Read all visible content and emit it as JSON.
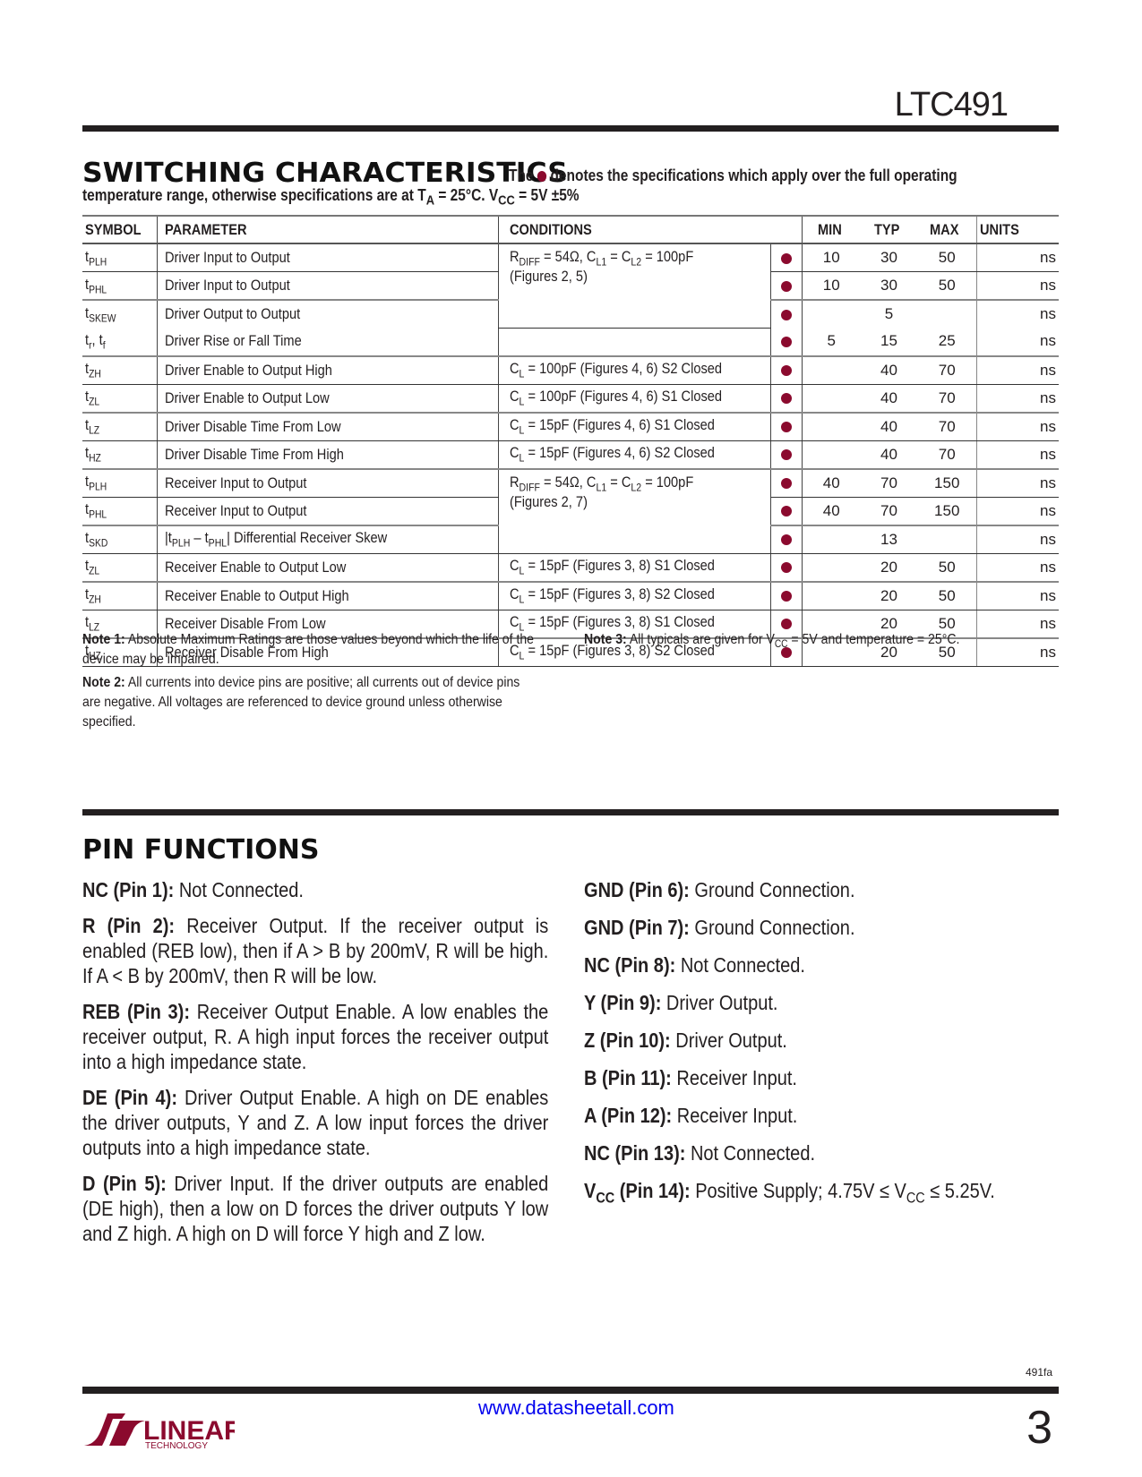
{
  "header": {
    "part_number": "LTC491"
  },
  "switching": {
    "title": "SWITCHING CHARACTERISTICS",
    "subtitle_prefix": "The",
    "subtitle_suffix": "denotes the specifications which apply over the full operating",
    "subtitle_line2": "temperature range, otherwise specifications are at T",
    "subtitle_line2_ta_sub": "A",
    "subtitle_line2_mid": " = 25°C. V",
    "subtitle_line2_vcc_sub": "CC",
    "subtitle_line2_end": " = 5V ±5%",
    "bullet_color": "#8b0a2e",
    "columns": {
      "symbol": "SYMBOL",
      "parameter": "PARAMETER",
      "conditions": "CONDITIONS",
      "min": "MIN",
      "typ": "TYP",
      "max": "MAX",
      "units": "UNITS"
    },
    "rows": [
      {
        "sym": "t",
        "sub": "PLH",
        "param": "Driver Input to Output",
        "cond": "R_DIFF = 54Ω, C_L1 = C_L2 = 100pF",
        "cond2": "(Figures 2, 5)",
        "min": "10",
        "typ": "30",
        "max": "50",
        "unit": "ns"
      },
      {
        "sym": "t",
        "sub": "PHL",
        "param": "Driver Input to Output",
        "cond": "",
        "min": "10",
        "typ": "30",
        "max": "50",
        "unit": "ns"
      },
      {
        "sym": "t",
        "sub": "SKEW",
        "param": "Driver Output to Output",
        "cond": "",
        "min": "",
        "typ": "5",
        "max": "",
        "unit": "ns"
      },
      {
        "sym": "t",
        "sub": "r",
        "sym2": ", t",
        "sub2": "f",
        "param": "Driver Rise or Fall Time",
        "cond": "",
        "min": "5",
        "typ": "15",
        "max": "25",
        "unit": "ns"
      },
      {
        "sym": "t",
        "sub": "ZH",
        "param": "Driver Enable to Output High",
        "cond": "C_L = 100pF (Figures 4, 6) S2 Closed",
        "min": "",
        "typ": "40",
        "max": "70",
        "unit": "ns"
      },
      {
        "sym": "t",
        "sub": "ZL",
        "param": "Driver Enable to Output Low",
        "cond": "C_L = 100pF (Figures 4, 6) S1 Closed",
        "min": "",
        "typ": "40",
        "max": "70",
        "unit": "ns"
      },
      {
        "sym": "t",
        "sub": "LZ",
        "param": "Driver Disable Time From Low",
        "cond": "C_L = 15pF (Figures 4, 6) S1 Closed",
        "min": "",
        "typ": "40",
        "max": "70",
        "unit": "ns"
      },
      {
        "sym": "t",
        "sub": "HZ",
        "param": "Driver Disable Time From High",
        "cond": "C_L = 15pF (Figures 4, 6) S2 Closed",
        "min": "",
        "typ": "40",
        "max": "70",
        "unit": "ns"
      },
      {
        "sym": "t",
        "sub": "PLH",
        "param": "Receiver Input to Output",
        "cond": "R_DIFF = 54Ω, C_L1 = C_L2 = 100pF",
        "cond2": "(Figures 2, 7)",
        "min": "40",
        "typ": "70",
        "max": "150",
        "unit": "ns"
      },
      {
        "sym": "t",
        "sub": "PHL",
        "param": "Receiver Input to Output",
        "cond": "",
        "min": "40",
        "typ": "70",
        "max": "150",
        "unit": "ns"
      },
      {
        "sym": "t",
        "sub": "SKD",
        "param": "|t_PLH – t_PHL| Differential Receiver Skew",
        "cond": "",
        "min": "",
        "typ": "13",
        "max": "",
        "unit": "ns"
      },
      {
        "sym": "t",
        "sub": "ZL",
        "param": "Receiver Enable to Output Low",
        "cond": "C_L = 15pF (Figures 3, 8) S1 Closed",
        "min": "",
        "typ": "20",
        "max": "50",
        "unit": "ns"
      },
      {
        "sym": "t",
        "sub": "ZH",
        "param": "Receiver Enable to Output High",
        "cond": "C_L = 15pF (Figures 3, 8) S2 Closed",
        "min": "",
        "typ": "20",
        "max": "50",
        "unit": "ns"
      },
      {
        "sym": "t",
        "sub": "LZ",
        "param": "Receiver Disable From Low",
        "cond": "C_L = 15pF (Figures 3, 8) S1 Closed",
        "min": "",
        "typ": "20",
        "max": "50",
        "unit": "ns"
      },
      {
        "sym": "t",
        "sub": "HZ",
        "param": "Receiver Disable From High",
        "cond": "C_L = 15pF (Figures 3, 8) S2 Closed",
        "min": "",
        "typ": "20",
        "max": "50",
        "unit": "ns"
      }
    ]
  },
  "notes": {
    "note1_label": "Note 1:",
    "note1_text": " Absolute Maximum Ratings are those values beyond which the life of the device may be impaired.",
    "note2_label": "Note 2:",
    "note2_text": " All currents into device pins are positive; all currents out of device pins are negative. All voltages are referenced to device ground unless otherwise specified.",
    "note3_label": "Note 3:",
    "note3_text": " All typicals are given for V_CC = 5V and temperature = 25°C."
  },
  "pin_functions": {
    "title": "PIN FUNCTIONS",
    "left": [
      {
        "label": "NC (Pin 1):",
        "text": " Not Connected."
      },
      {
        "label": "R (Pin 2):",
        "text": " Receiver Output. If the receiver output is enabled (REB low), then if A > B by 200mV, R will be high. If A < B by 200mV, then R will be low."
      },
      {
        "label": "REB (Pin 3):",
        "text": " Receiver Output Enable. A low enables the receiver output, R. A high input forces the receiver output into a high impedance state."
      },
      {
        "label": "DE (Pin 4):",
        "text": " Driver Output Enable. A high on DE enables the driver outputs, Y and Z. A low input forces the driver outputs into a high impedance state."
      },
      {
        "label": "D (Pin 5):",
        "text": " Driver Input. If the driver outputs are enabled (DE high), then a low on D forces the driver outputs Y low and Z high. A high on D will force Y high and Z low."
      }
    ],
    "right": [
      {
        "label": "GND (Pin 6):",
        "text": " Ground Connection."
      },
      {
        "label": "GND (Pin 7):",
        "text": " Ground Connection."
      },
      {
        "label": "NC (Pin 8):",
        "text": " Not Connected."
      },
      {
        "label": "Y (Pin 9):",
        "text": " Driver Output."
      },
      {
        "label": "Z (Pin 10):",
        "text": " Driver Output."
      },
      {
        "label": "B (Pin 11):",
        "text": " Receiver Input."
      },
      {
        "label": "A (Pin 12):",
        "text": " Receiver Input."
      },
      {
        "label": "NC (Pin 13):",
        "text": " Not Connected."
      },
      {
        "label": "V_CC (Pin 14):",
        "text": " Positive Supply; 4.75V ≤ V_CC ≤ 5.25V."
      }
    ]
  },
  "footer": {
    "doc_code": "491fa",
    "website": "www.datasheetall.com",
    "page_number": "3",
    "logo_word": "LINEAR",
    "logo_sub": "TECHNOLOGY",
    "logo_color": "#8b0a2e",
    "link_color": "#0000ee"
  }
}
